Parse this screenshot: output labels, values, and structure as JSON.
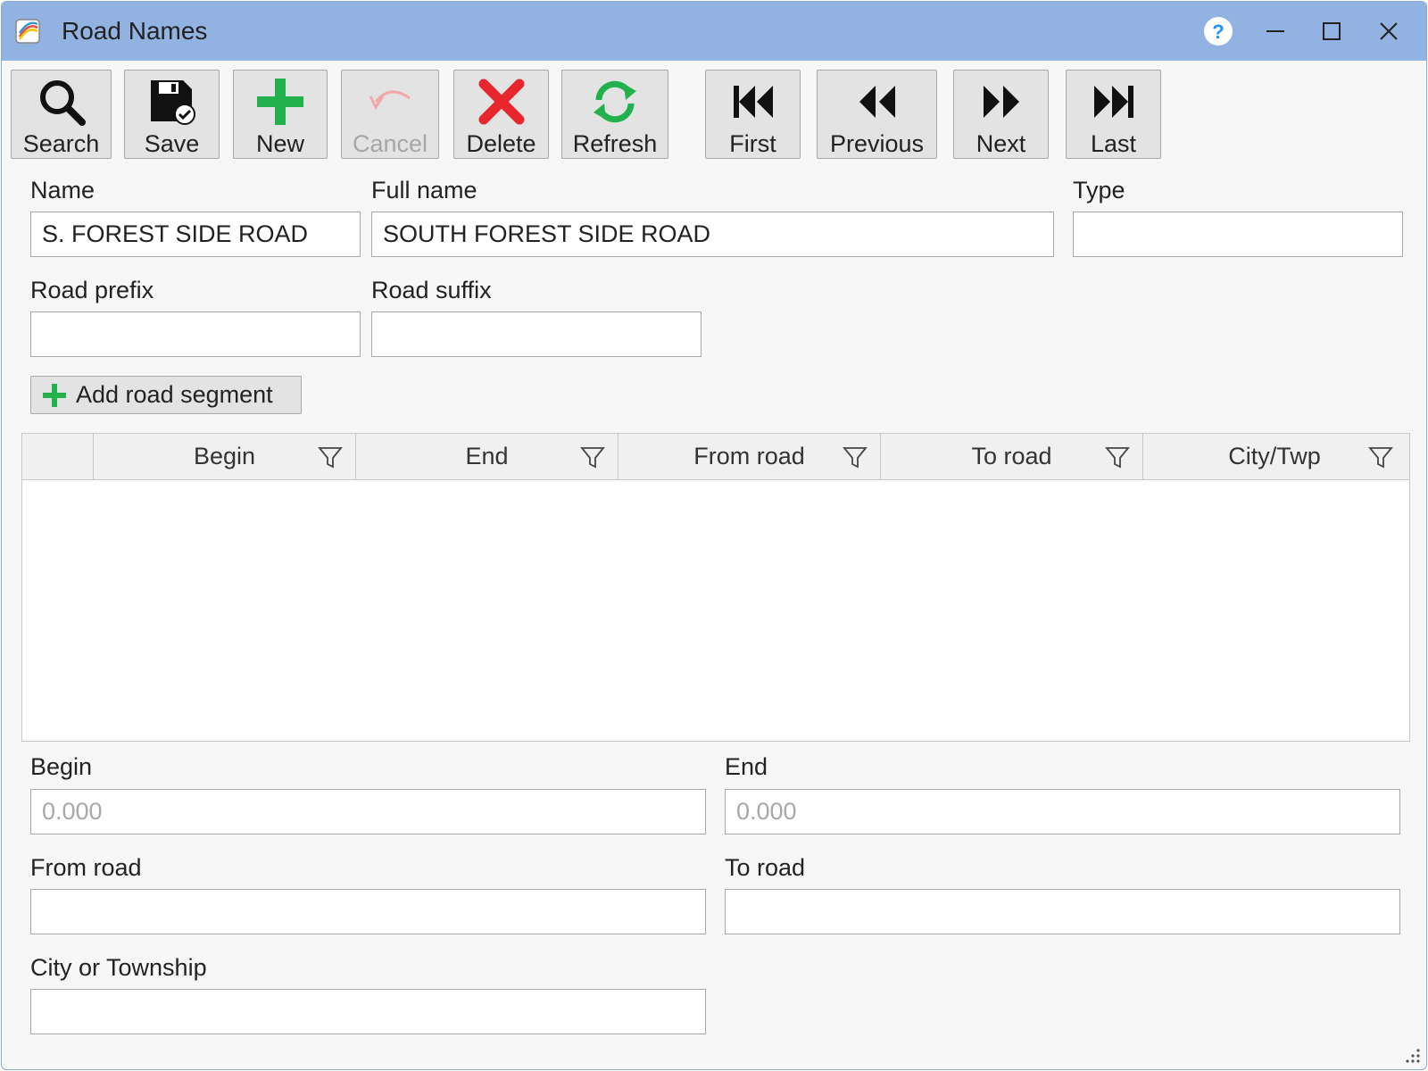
{
  "window": {
    "title": "Road Names"
  },
  "toolbar": {
    "search": "Search",
    "save": "Save",
    "new": "New",
    "cancel": "Cancel",
    "delete": "Delete",
    "refresh": "Refresh",
    "first": "First",
    "previous": "Previous",
    "next": "Next",
    "last": "Last"
  },
  "form": {
    "name_label": "Name",
    "name_value": "S. FOREST SIDE ROAD",
    "full_name_label": "Full name",
    "full_name_value": "SOUTH FOREST SIDE ROAD",
    "type_label": "Type",
    "type_value": "",
    "road_prefix_label": "Road prefix",
    "road_prefix_value": "",
    "road_suffix_label": "Road suffix",
    "road_suffix_value": "",
    "add_segment_label": "Add road segment"
  },
  "grid": {
    "columns": [
      "Begin",
      "End",
      "From road",
      "To road",
      "City/Twp"
    ],
    "rows": []
  },
  "segment": {
    "begin_label": "Begin",
    "begin_placeholder": "0.000",
    "end_label": "End",
    "end_placeholder": "0.000",
    "from_road_label": "From road",
    "to_road_label": "To road",
    "city_label": "City or Township"
  },
  "colors": {
    "titlebar": "#92b2e1",
    "accent_green": "#22b14c",
    "delete_red": "#e8262d"
  }
}
